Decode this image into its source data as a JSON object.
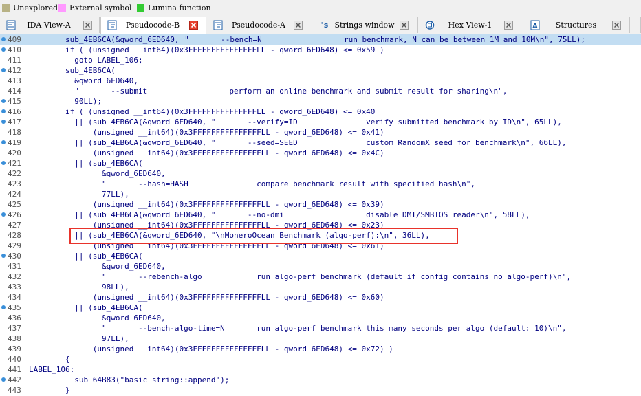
{
  "legend": [
    {
      "label": "Unexplored",
      "color": "#b8b285"
    },
    {
      "label": "External symbol",
      "color": "#ff99ff"
    },
    {
      "label": "Lumina function",
      "color": "#33cc33"
    }
  ],
  "tabs": [
    {
      "label": "IDA View-A",
      "icon": "ida-view-icon",
      "active": false
    },
    {
      "label": "Pseudocode-B",
      "icon": "pseudocode-icon",
      "active": true
    },
    {
      "label": "Pseudocode-A",
      "icon": "pseudocode-icon",
      "active": false
    },
    {
      "label": "Strings window",
      "icon": "strings-icon",
      "active": false
    },
    {
      "label": "Hex View-1",
      "icon": "hex-view-icon",
      "active": false
    },
    {
      "label": "Structures",
      "icon": "structures-icon",
      "active": false
    }
  ],
  "code_lines": [
    {
      "num": "409",
      "bp": true,
      "hl": true,
      "cursor_after": "sub_4EB6CA(&qword_6ED640, ",
      "text": "\"       --bench=N                  run benchmark, N can be between 1M and 10M\\n\", 75LL);",
      "indent": "        "
    },
    {
      "num": "410",
      "bp": true,
      "text": "if ( (unsigned __int64)(0x3FFFFFFFFFFFFFFFLL - qword_6ED648) <= 0x59 )",
      "indent": "        "
    },
    {
      "num": "411",
      "bp": false,
      "text": "goto LABEL_106;",
      "indent": "          "
    },
    {
      "num": "412",
      "bp": true,
      "text": "sub_4EB6CA(",
      "indent": "        "
    },
    {
      "num": "413",
      "bp": false,
      "text": "&qword_6ED640,",
      "indent": "          "
    },
    {
      "num": "414",
      "bp": false,
      "text": "\"       --submit                  perform an online benchmark and submit result for sharing\\n\",",
      "indent": "          "
    },
    {
      "num": "415",
      "bp": true,
      "text": "90LL);",
      "indent": "          "
    },
    {
      "num": "416",
      "bp": true,
      "text": "if ( (unsigned __int64)(0x3FFFFFFFFFFFFFFFLL - qword_6ED648) <= 0x40",
      "indent": "        "
    },
    {
      "num": "417",
      "bp": true,
      "text": "|| (sub_4EB6CA(&qword_6ED640, \"       --verify=ID               verify submitted benchmark by ID\\n\", 65LL),",
      "indent": "          "
    },
    {
      "num": "418",
      "bp": false,
      "text": "(unsigned __int64)(0x3FFFFFFFFFFFFFFFLL - qword_6ED648) <= 0x41)",
      "indent": "              "
    },
    {
      "num": "419",
      "bp": true,
      "text": "|| (sub_4EB6CA(&qword_6ED640, \"       --seed=SEED               custom RandomX seed for benchmark\\n\", 66LL),",
      "indent": "          "
    },
    {
      "num": "420",
      "bp": false,
      "text": "(unsigned __int64)(0x3FFFFFFFFFFFFFFFLL - qword_6ED648) <= 0x4C)",
      "indent": "              "
    },
    {
      "num": "421",
      "bp": true,
      "text": "|| (sub_4EB6CA(",
      "indent": "          "
    },
    {
      "num": "422",
      "bp": false,
      "text": "&qword_6ED640,",
      "indent": "                "
    },
    {
      "num": "423",
      "bp": false,
      "text": "\"       --hash=HASH               compare benchmark result with specified hash\\n\",",
      "indent": "                "
    },
    {
      "num": "424",
      "bp": false,
      "text": "77LL),",
      "indent": "                "
    },
    {
      "num": "425",
      "bp": false,
      "text": "(unsigned __int64)(0x3FFFFFFFFFFFFFFFLL - qword_6ED648) <= 0x39)",
      "indent": "              "
    },
    {
      "num": "426",
      "bp": true,
      "text": "|| (sub_4EB6CA(&qword_6ED640, \"       --no-dmi                  disable DMI/SMBIOS reader\\n\", 58LL),",
      "indent": "          "
    },
    {
      "num": "427",
      "bp": false,
      "text": "(unsigned __int64)(0x3FFFFFFFFFFFFFFFLL - qword_6ED648) <= 0x23)",
      "indent": "              "
    },
    {
      "num": "428",
      "bp": false,
      "text": "|| (sub_4EB6CA(&qword_6ED640, \"\\nMoneroOcean Benchmark (algo-perf):\\n\", 36LL),",
      "indent": "          "
    },
    {
      "num": "429",
      "bp": false,
      "text": "(unsigned __int64)(0x3FFFFFFFFFFFFFFFLL - qword_6ED648) <= 0x61)",
      "indent": "              "
    },
    {
      "num": "430",
      "bp": true,
      "text": "|| (sub_4EB6CA(",
      "indent": "          "
    },
    {
      "num": "431",
      "bp": false,
      "text": "&qword_6ED640,",
      "indent": "                "
    },
    {
      "num": "432",
      "bp": false,
      "text": "\"       --rebench-algo            run algo-perf benchmark (default if config contains no algo-perf)\\n\",",
      "indent": "                "
    },
    {
      "num": "433",
      "bp": false,
      "text": "98LL),",
      "indent": "                "
    },
    {
      "num": "434",
      "bp": false,
      "text": "(unsigned __int64)(0x3FFFFFFFFFFFFFFFLL - qword_6ED648) <= 0x60)",
      "indent": "              "
    },
    {
      "num": "435",
      "bp": true,
      "text": "|| (sub_4EB6CA(",
      "indent": "          "
    },
    {
      "num": "436",
      "bp": false,
      "text": "&qword_6ED640,",
      "indent": "                "
    },
    {
      "num": "437",
      "bp": false,
      "text": "\"       --bench-algo-time=N       run algo-perf benchmark this many seconds per algo (default: 10)\\n\",",
      "indent": "                "
    },
    {
      "num": "438",
      "bp": false,
      "text": "97LL),",
      "indent": "                "
    },
    {
      "num": "439",
      "bp": false,
      "text": "(unsigned __int64)(0x3FFFFFFFFFFFFFFFLL - qword_6ED648) <= 0x72) )",
      "indent": "              "
    },
    {
      "num": "440",
      "bp": false,
      "text": "{",
      "indent": "        "
    },
    {
      "num": "441",
      "bp": false,
      "text": "LABEL_106:",
      "indent": ""
    },
    {
      "num": "442",
      "bp": true,
      "text": "sub_64B83(\"basic_string::append\");",
      "indent": "          "
    },
    {
      "num": "443",
      "bp": false,
      "text": "}",
      "indent": "        "
    }
  ],
  "highlight_box_line": "428",
  "colors": {
    "highlight": "#c2ddf2",
    "breakpoint": "#3a8fd9",
    "annotation_box": "#e8332b",
    "code_text": "#000080"
  }
}
